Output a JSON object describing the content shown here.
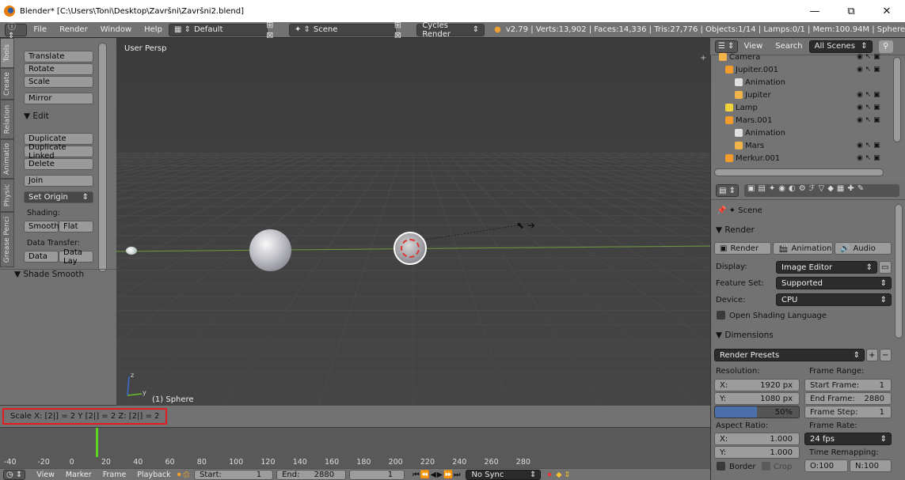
{
  "window": {
    "title": "Blender* [C:\\Users\\Toni\\Desktop\\Završni\\Završni2.blend]",
    "minimize": "—",
    "maximize": "⧉",
    "close": "✕"
  },
  "info_header": {
    "menus": [
      "File",
      "Render",
      "Window",
      "Help"
    ],
    "layout": "Default",
    "scene": "Scene",
    "engine": "Cycles Render",
    "stats": "v2.79 | Verts:13,902 | Faces:14,336 | Tris:27,776 | Objects:1/14 | Lamps:0/1 | Mem:100.94M | Sphere"
  },
  "tool_shelf": {
    "tabs": [
      "Tools",
      "Create",
      "Relation",
      "Animatio",
      "Physic",
      "Grease Penci"
    ],
    "transform_buttons": [
      "Translate",
      "Rotate",
      "Scale"
    ],
    "mirror": "Mirror",
    "edit_header": "▼ Edit",
    "edit_buttons": [
      "Duplicate",
      "Duplicate Linked",
      "Delete"
    ],
    "join": "Join",
    "set_origin": "Set Origin",
    "shading_label": "Shading:",
    "smooth": "Smooth",
    "flat": "Flat",
    "data_transfer_label": "Data Transfer:",
    "data": "Data",
    "data_lay": "Data Lay",
    "shade_smooth_header": "▼ Shade Smooth"
  },
  "viewport": {
    "view_name": "User Persp",
    "object_label": "(1) Sphere",
    "axis_y": "y",
    "axis_z": "z"
  },
  "operator_status": "Scale X: [2|] = 2  Y [2|] = 2  Z: [2|] = 2",
  "timeline": {
    "ruler": [
      "-40",
      "-20",
      "0",
      "20",
      "40",
      "60",
      "80",
      "100",
      "120",
      "140",
      "160",
      "180",
      "200",
      "220",
      "240",
      "260",
      "280"
    ],
    "menus": [
      "View",
      "Marker",
      "Frame",
      "Playback"
    ],
    "start_label": "Start:",
    "start_value": "1",
    "end_label": "End:",
    "end_value": "2880",
    "current_frame": "1",
    "sync": "No Sync"
  },
  "outliner": {
    "view": "View",
    "search": "Search",
    "filter": "All Scenes",
    "rows": [
      "Camera",
      "Jupiter.001",
      "Animation",
      "Jupiter",
      "Lamp",
      "Mars.001",
      "Animation",
      "Mars",
      "Merkur.001"
    ]
  },
  "properties": {
    "context": "Scene",
    "render_header": "▼ Render",
    "render_btn": "Render",
    "animation_btn": "Animation",
    "audio_btn": "Audio",
    "display_label": "Display:",
    "display_value": "Image Editor",
    "feature_label": "Feature Set:",
    "feature_value": "Supported",
    "device_label": "Device:",
    "device_value": "CPU",
    "osl": "Open Shading Language",
    "dimensions_header": "▼ Dimensions",
    "presets": "Render Presets",
    "resolution_label": "Resolution:",
    "res_x_label": "X:",
    "res_x": "1920 px",
    "res_y_label": "Y:",
    "res_y": "1080 px",
    "res_pct": "50%",
    "frame_range_label": "Frame Range:",
    "start_frame_label": "Start Frame:",
    "start_frame": "1",
    "end_frame_label": "End Frame:",
    "end_frame": "2880",
    "frame_step_label": "Frame Step:",
    "frame_step": "1",
    "aspect_label": "Aspect Ratio:",
    "asp_x_label": "X:",
    "asp_x": "1.000",
    "asp_y_label": "Y:",
    "asp_y": "1.000",
    "frame_rate_label": "Frame Rate:",
    "fps": "24 fps",
    "time_remap_label": "Time Remapping:",
    "border": "Border",
    "crop": "Crop",
    "old": "O:100",
    "new": "N:100"
  },
  "colors": {
    "highlight": "#e31b23",
    "timeline_cursor": "#5fd31c",
    "blue_field": "#4b6fa8"
  }
}
